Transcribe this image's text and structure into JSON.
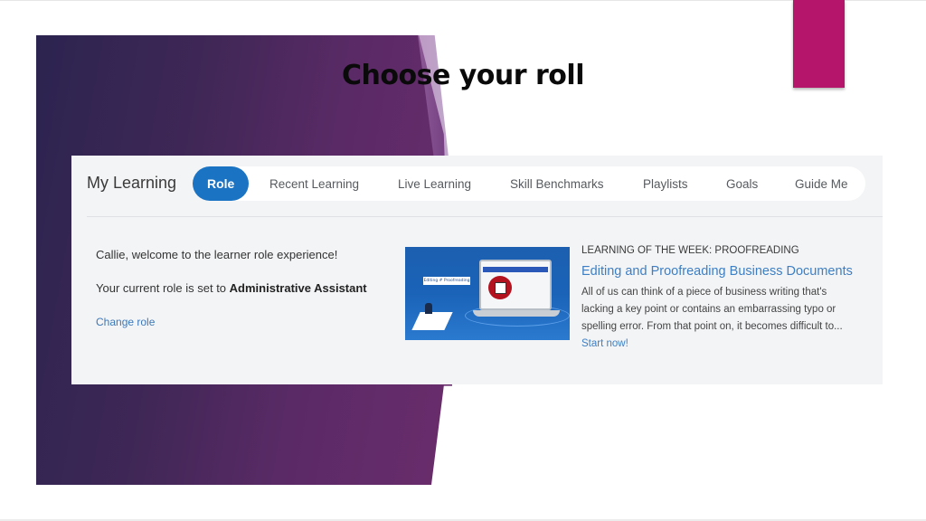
{
  "slide": {
    "title": "Choose your roll",
    "accent_colors": {
      "purple_background": "#4a2860",
      "magenta_tab": "#b5166b"
    }
  },
  "app": {
    "section_title": "My Learning",
    "tabs": [
      {
        "label": "Role",
        "active": true
      },
      {
        "label": "Recent Learning",
        "active": false
      },
      {
        "label": "Live Learning",
        "active": false
      },
      {
        "label": "Skill Benchmarks",
        "active": false
      },
      {
        "label": "Playlists",
        "active": false
      },
      {
        "label": "Goals",
        "active": false
      },
      {
        "label": "Guide Me",
        "active": false
      }
    ],
    "accent_color": "#1b73c3",
    "role_panel": {
      "welcome": "Callie, welcome to the learner role experience!",
      "role_prefix": "Your current role is set to",
      "role_name": "Administrative Assistant",
      "change_role_link": "Change role"
    },
    "learning_of_week": {
      "label": "LEARNING OF THE WEEK: PROOFREADING",
      "thumbnail_caption": "Editing # Proofreading",
      "course_title": "Editing and Proofreading Business Documents",
      "description": "All of us can think of a piece of business writing that's lacking a key point or contains an embarrassing typo or spelling error. From that point on, it becomes difficult to...",
      "start_link": "Start now!",
      "link_color": "#3d7fc4"
    }
  }
}
